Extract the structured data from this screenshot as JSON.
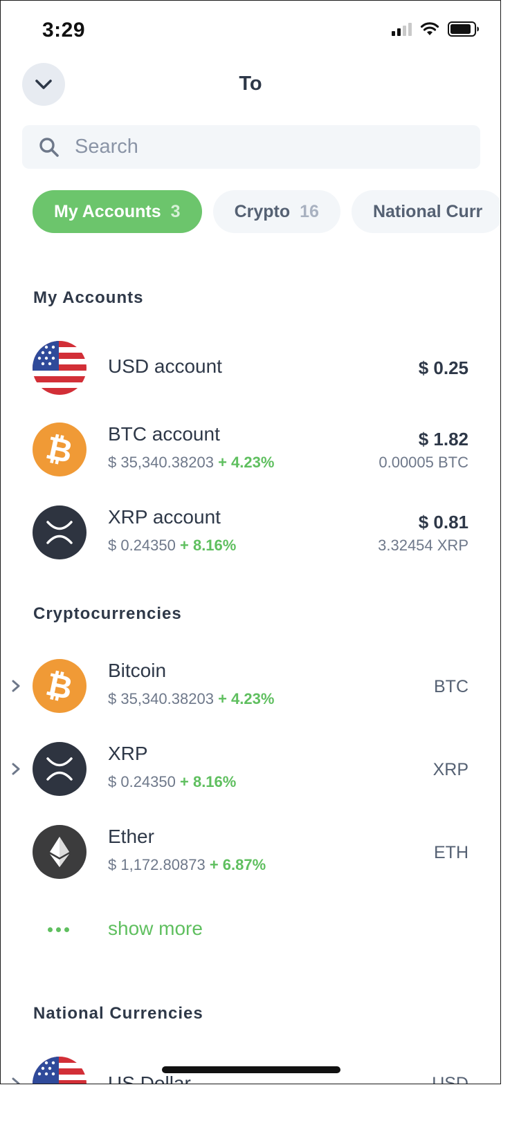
{
  "status_bar": {
    "time": "3:29"
  },
  "header": {
    "title": "To"
  },
  "search": {
    "placeholder": "Search"
  },
  "chips": [
    {
      "label": "My Accounts",
      "count": "3",
      "active": true
    },
    {
      "label": "Crypto",
      "count": "16",
      "active": false
    },
    {
      "label": "National Curr",
      "count": "",
      "active": false
    }
  ],
  "my_accounts": {
    "title": "My Accounts",
    "items": [
      {
        "name": "USD account",
        "amount": "$ 0.25",
        "icon": "us-flag-icon"
      },
      {
        "name": "BTC account",
        "price": "$ 35,340.38203",
        "change": "+ 4.23%",
        "amount": "$ 1.82",
        "native": "0.00005 BTC",
        "icon": "bitcoin-icon"
      },
      {
        "name": "XRP account",
        "price": "$ 0.24350",
        "change": "+ 8.16%",
        "amount": "$ 0.81",
        "native": "3.32454 XRP",
        "icon": "xrp-icon"
      }
    ]
  },
  "cryptocurrencies": {
    "title": "Cryptocurrencies",
    "items": [
      {
        "name": "Bitcoin",
        "price": "$ 35,340.38203",
        "change": "+ 4.23%",
        "code": "BTC",
        "icon": "bitcoin-icon"
      },
      {
        "name": "XRP",
        "price": "$ 0.24350",
        "change": "+ 8.16%",
        "code": "XRP",
        "icon": "xrp-icon"
      },
      {
        "name": "Ether",
        "price": "$ 1,172.80873",
        "change": "+ 6.87%",
        "code": "ETH",
        "icon": "ether-icon"
      }
    ],
    "show_more": "show more"
  },
  "national_currencies": {
    "title": "National Currencies",
    "items": [
      {
        "name": "US Dollar",
        "code": "USD",
        "icon": "us-flag-icon"
      }
    ]
  },
  "colors": {
    "accent_green": "#6cc56c",
    "positive_change": "#5fbf5f",
    "bitcoin_orange": "#f09a36",
    "xrp_dark": "#2e3440",
    "text_dark": "#2e3848",
    "text_muted": "#6e788a"
  }
}
